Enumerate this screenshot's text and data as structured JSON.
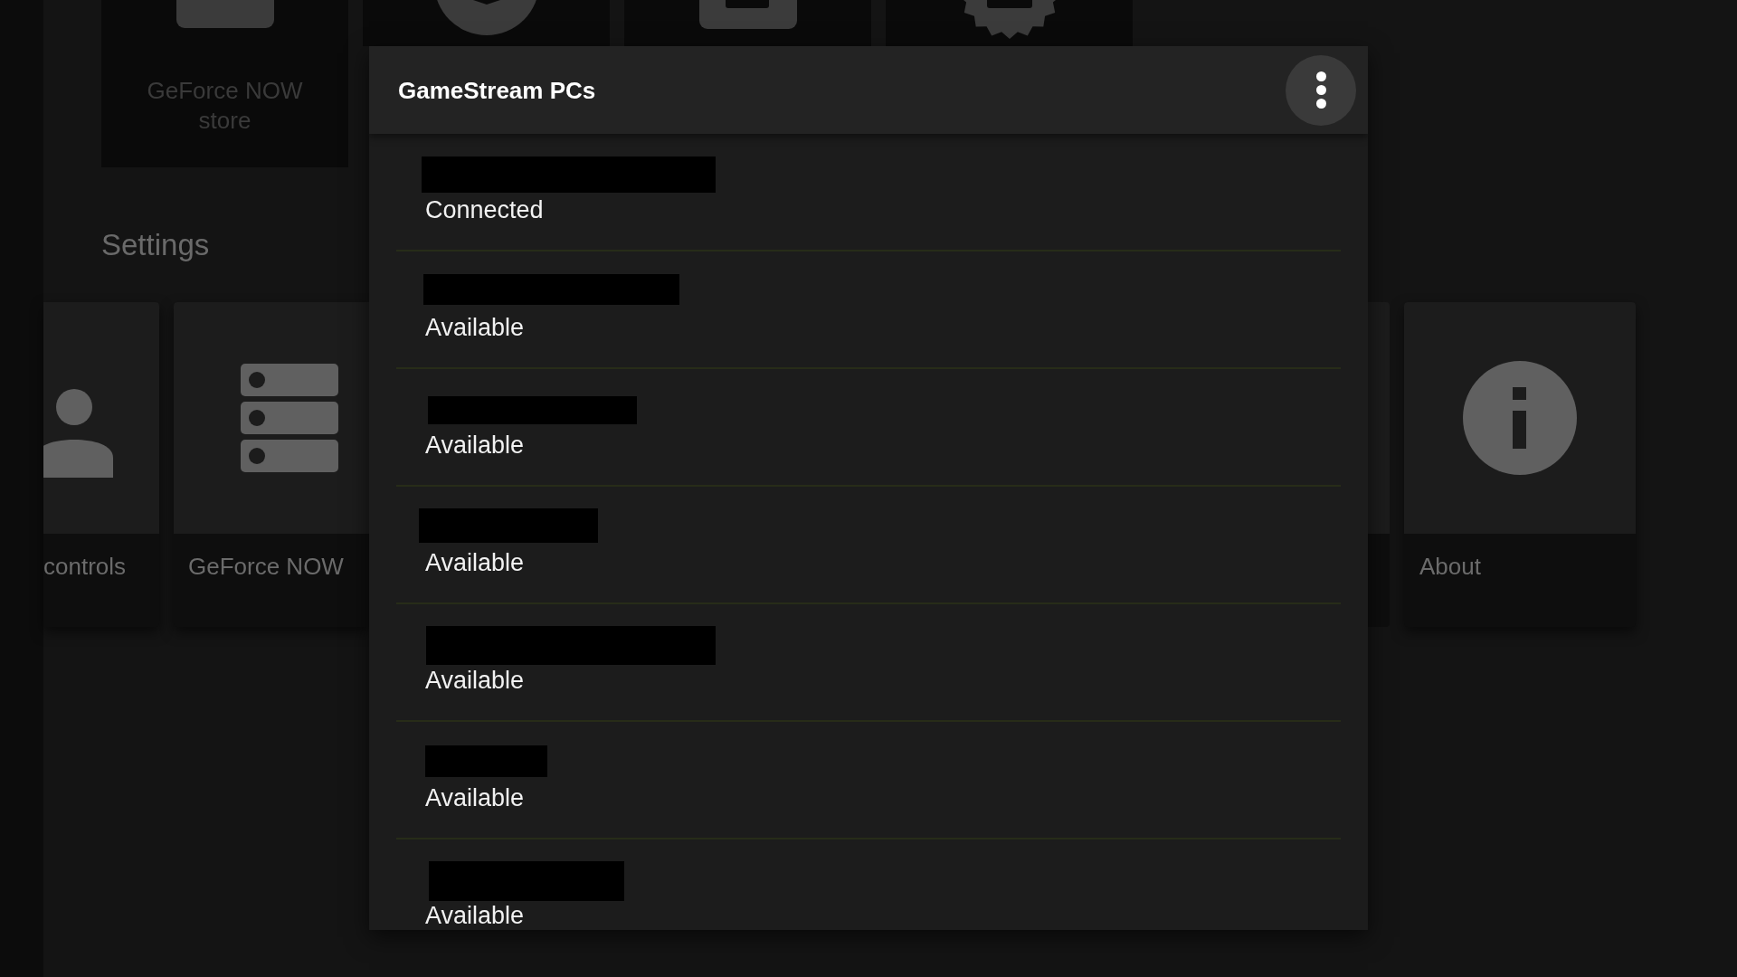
{
  "top_tiles": [
    {
      "label": "GeForce NOW store"
    }
  ],
  "settings": {
    "title": "Settings",
    "tiles": [
      {
        "kind": "account",
        "label": "controls"
      },
      {
        "kind": "service",
        "label": "GeForce NOW"
      },
      {
        "kind": "info",
        "label": "About"
      }
    ]
  },
  "dialog": {
    "title": "GameStream PCs",
    "pcs": [
      {
        "name_redacted": true,
        "status": "Connected"
      },
      {
        "name_redacted": true,
        "status": "Available"
      },
      {
        "name_redacted": true,
        "status": "Available"
      },
      {
        "name_redacted": true,
        "status": "Available"
      },
      {
        "name_redacted": true,
        "status": "Available"
      },
      {
        "name_redacted": true,
        "status": "Available"
      },
      {
        "name_redacted": true,
        "status": "Available"
      }
    ]
  }
}
